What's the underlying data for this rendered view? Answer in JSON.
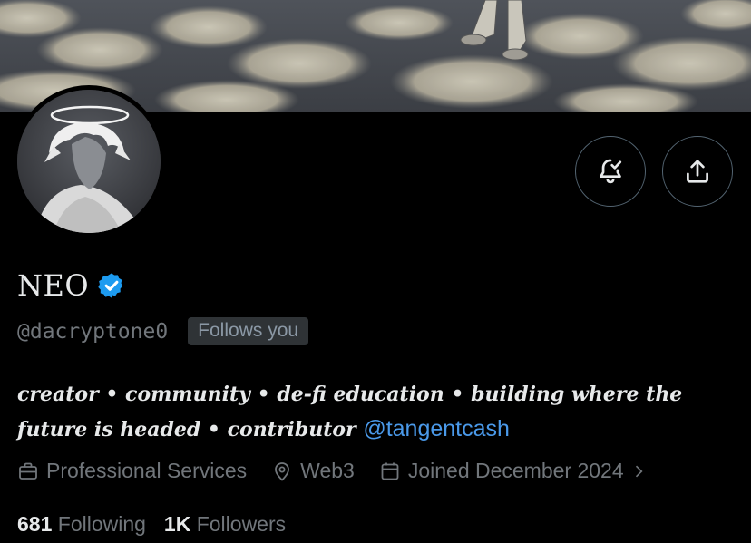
{
  "profile": {
    "name": "NEO",
    "handle": "@dacryptone0",
    "follows_you": "Follows you",
    "bio_text": "creator • community • de-fi education • building where the future is headed • contributor",
    "bio_mention": "@tangentcash",
    "category": "Professional Services",
    "location": "Web3",
    "joined": "Joined December 2024",
    "following_count": "681",
    "following_label": "Following",
    "followers_count": "1K",
    "followers_label": "Followers"
  },
  "colors": {
    "background": "#000000",
    "accent": "#1d9bf0",
    "muted_text": "#71767b",
    "badge_bg": "#2f3336"
  },
  "icons": {
    "notify": "bell-check-icon",
    "share": "share-upload-icon",
    "category": "briefcase-icon",
    "location": "location-pin-icon",
    "joined": "calendar-icon",
    "verified": "verified-badge-icon"
  }
}
